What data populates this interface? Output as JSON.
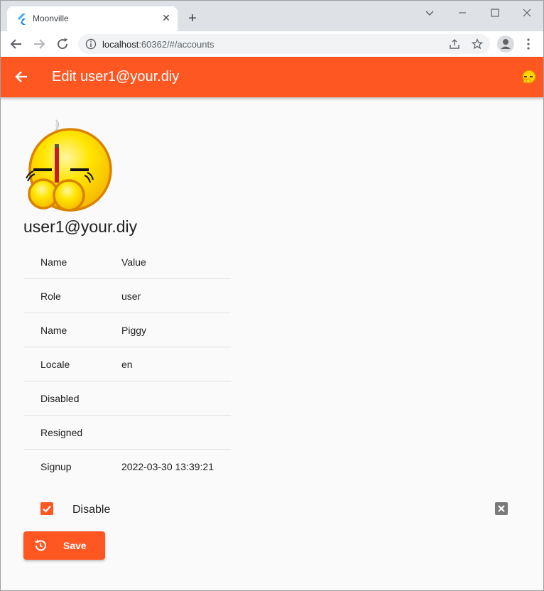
{
  "browser": {
    "tab_title": "Moonville",
    "url_host": "localhost",
    "url_rest": ":60362/#/accounts"
  },
  "appbar": {
    "title": "Edit user1@your.diy",
    "color": "#ff5722"
  },
  "account": {
    "email": "user1@your.diy"
  },
  "table": {
    "header": {
      "name": "Name",
      "value": "Value"
    },
    "rows": [
      {
        "name": "Role",
        "value": "user"
      },
      {
        "name": "Name",
        "value": "Piggy"
      },
      {
        "name": "Locale",
        "value": "en"
      },
      {
        "name": "Disabled",
        "value": ""
      },
      {
        "name": "Resigned",
        "value": ""
      },
      {
        "name": "Signup",
        "value": "2022-03-30 13:39:21"
      }
    ]
  },
  "disable_toggle": {
    "label": "Disable",
    "checked": true
  },
  "save_button": {
    "label": "Save"
  }
}
